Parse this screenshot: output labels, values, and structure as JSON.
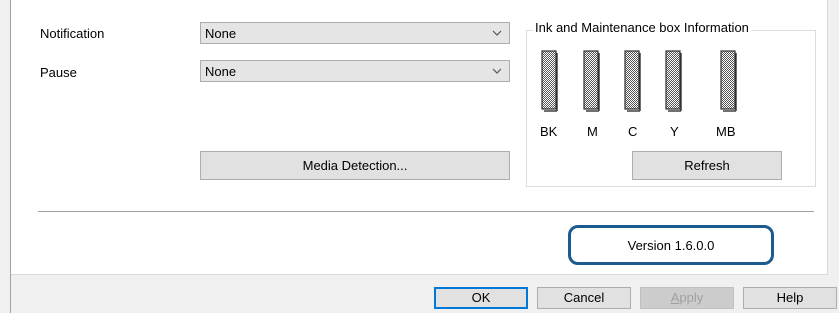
{
  "form": {
    "notification_label": "Notification",
    "notification_value": "None",
    "pause_label": "Pause",
    "pause_value": "None",
    "media_detection_label": "Media Detection..."
  },
  "ink": {
    "group_title": "Ink and Maintenance box Information",
    "cartridges": [
      {
        "label": "BK",
        "level": 1.0
      },
      {
        "label": "M",
        "level": 1.0
      },
      {
        "label": "C",
        "level": 1.0
      },
      {
        "label": "Y",
        "level": 1.0
      },
      {
        "label": "MB",
        "level": 1.0
      }
    ],
    "refresh_label": "Refresh"
  },
  "version": {
    "text": "Version 1.6.0.0",
    "highlight_color": "#1d5a8e"
  },
  "dialog_buttons": {
    "ok": "OK",
    "cancel": "Cancel",
    "apply_accel": "A",
    "apply_rest": "pply",
    "help": "Help"
  },
  "icons": {
    "dropdown": "chevron-down-icon",
    "cartridge": "ink-cartridge-icon"
  }
}
